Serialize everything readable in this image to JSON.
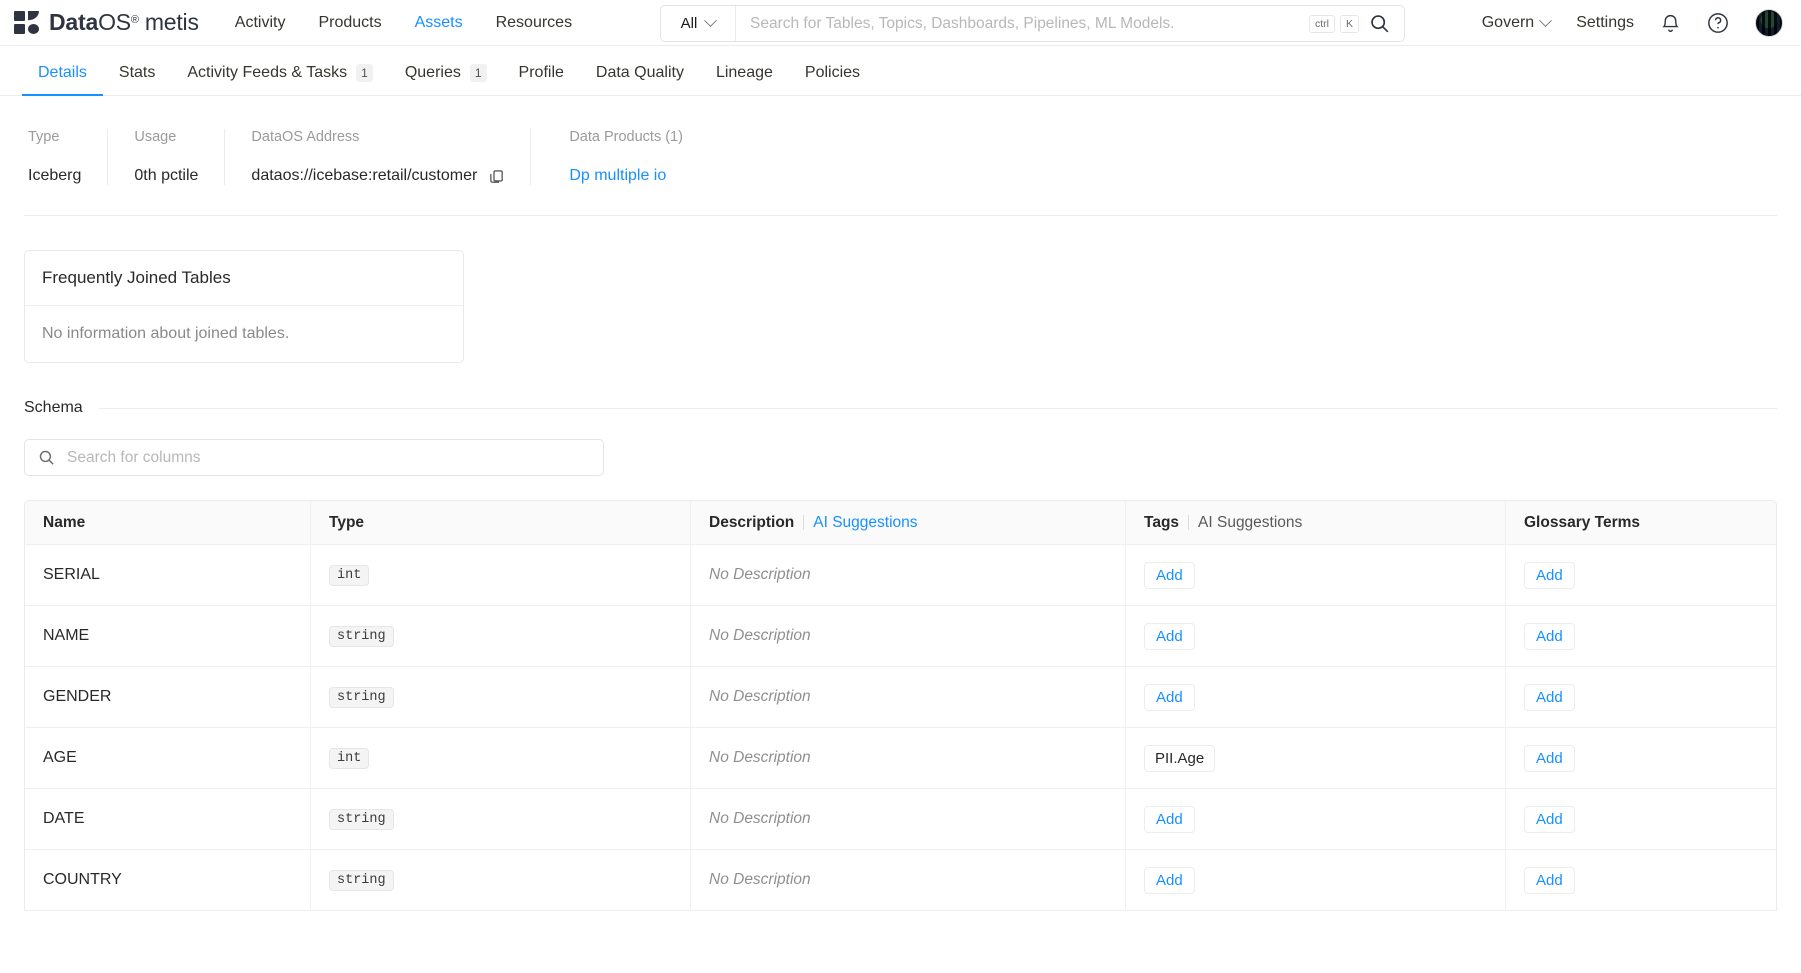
{
  "brand": {
    "name_bold": "Data",
    "name_light": "OS",
    "registered": "®",
    "product": "metis"
  },
  "nav": {
    "items": [
      {
        "label": "Activity",
        "active": false
      },
      {
        "label": "Products",
        "active": false
      },
      {
        "label": "Assets",
        "active": true
      },
      {
        "label": "Resources",
        "active": false
      }
    ]
  },
  "search": {
    "scope": "All",
    "placeholder": "Search for Tables, Topics, Dashboards, Pipelines, ML Models.",
    "value": "",
    "kbd_ctrl": "ctrl",
    "kbd_key": "K",
    "search_icon": "search-icon"
  },
  "header_right": {
    "govern": "Govern",
    "settings": "Settings",
    "bell_icon": "bell-icon",
    "help_icon": "help-circle-icon",
    "avatar": "user-avatar"
  },
  "tabs": [
    {
      "label": "Details",
      "count": "",
      "active": true
    },
    {
      "label": "Stats",
      "count": "",
      "active": false
    },
    {
      "label": "Activity Feeds & Tasks",
      "count": "1",
      "active": false
    },
    {
      "label": "Queries",
      "count": "1",
      "active": false
    },
    {
      "label": "Profile",
      "count": "",
      "active": false
    },
    {
      "label": "Data Quality",
      "count": "",
      "active": false
    },
    {
      "label": "Lineage",
      "count": "",
      "active": false
    },
    {
      "label": "Policies",
      "count": "",
      "active": false
    }
  ],
  "meta": {
    "type_label": "Type",
    "type_value": "Iceberg",
    "usage_label": "Usage",
    "usage_value": "0th pctile",
    "address_label": "DataOS Address",
    "address_value": "dataos://icebase:retail/customer",
    "copy_icon": "copy-icon",
    "products_label": "Data Products (1)",
    "products_value": "Dp multiple io"
  },
  "joined_card": {
    "title": "Frequently Joined Tables",
    "empty_text": "No information about joined tables."
  },
  "schema": {
    "section_title": "Schema",
    "search_placeholder": "Search for columns",
    "search_value": "",
    "search_icon": "search-icon",
    "columns": {
      "name": "Name",
      "type": "Type",
      "description": "Description",
      "description_ai": "AI Suggestions",
      "tags": "Tags",
      "tags_ai": "AI Suggestions",
      "glossary": "Glossary Terms"
    },
    "add_label": "Add",
    "rows": [
      {
        "name": "SERIAL",
        "type": "int",
        "description": "No Description",
        "tags": [],
        "glossary": []
      },
      {
        "name": "NAME",
        "type": "string",
        "description": "No Description",
        "tags": [],
        "glossary": []
      },
      {
        "name": "GENDER",
        "type": "string",
        "description": "No Description",
        "tags": [],
        "glossary": []
      },
      {
        "name": "AGE",
        "type": "int",
        "description": "No Description",
        "tags": [
          "PII.Age"
        ],
        "glossary": []
      },
      {
        "name": "DATE",
        "type": "string",
        "description": "No Description",
        "tags": [],
        "glossary": []
      },
      {
        "name": "COUNTRY",
        "type": "string",
        "description": "No Description",
        "tags": [],
        "glossary": []
      }
    ]
  },
  "colors": {
    "accent": "#1890ff",
    "text": "#292929",
    "muted": "#9b9b9b",
    "border": "#ececec",
    "brand_dark": "#2e3440"
  }
}
